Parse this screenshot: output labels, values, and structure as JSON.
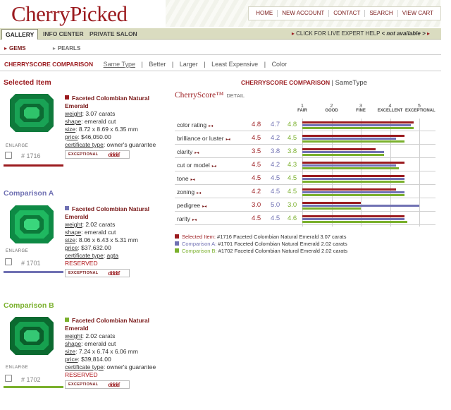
{
  "header": {
    "logo": "CherryPicked",
    "nav": [
      "HOME",
      "NEW ACCOUNT",
      "CONTACT",
      "SEARCH",
      "VIEW CART"
    ]
  },
  "tabs": [
    "GALLERY",
    "INFO CENTER",
    "PRIVATE SALON"
  ],
  "expert": {
    "text": "CLICK FOR LIVE EXPERT HELP",
    "status": "< not available >"
  },
  "subnav": {
    "gems": "GEMS",
    "pearls": "PEARLS"
  },
  "comparison_bar": {
    "label": "CHERRYSCORE COMPARISON",
    "options": [
      "Same Type",
      "Better",
      "Larger",
      "Least Expensive",
      "Color"
    ]
  },
  "colors": {
    "selected": "#9b1b1f",
    "comparison_a": "#7071b3",
    "comparison_b": "#7ab02c"
  },
  "items": [
    {
      "heading": "Selected Item",
      "name": "Faceted Colombian Natural Emerald",
      "weight_label": "weight",
      "weight": "3.07 carats",
      "shape_label": "shape",
      "shape": "emerald cut",
      "size_label": "size",
      "size": "8.72 x 8.69 x 6.35 mm",
      "price_label": "price",
      "price": "$46,050.00",
      "cert_label": "certificate type",
      "cert": "owner's guarantee",
      "status": "",
      "id": "# 1716",
      "enlarge": "ENLARGE",
      "badge": "EXCEPTIONAL"
    },
    {
      "heading": "Comparison A",
      "name": "Faceted Colombian Natural Emerald",
      "weight_label": "weight",
      "weight": "2.02 carats",
      "shape_label": "shape",
      "shape": "emerald cut",
      "size_label": "size",
      "size": "8.06 x 6.43 x 5.31 mm",
      "price_label": "price",
      "price": "$37,632.00",
      "cert_label": "certificate type",
      "cert": "agta",
      "status": "RESERVED",
      "id": "# 1701",
      "enlarge": "ENLARGE",
      "badge": "EXCEPTIONAL"
    },
    {
      "heading": "Comparison B",
      "name": "Faceted Colombian Natural Emerald",
      "weight_label": "weight",
      "weight": "2.02 carats",
      "shape_label": "shape",
      "shape": "emerald cut",
      "size_label": "size",
      "size": "7.24 x 6.74 x 6.06 mm",
      "price_label": "price",
      "price": "$39,814.00",
      "cert_label": "certificate type",
      "cert": "owner's guarantee",
      "status": "RESERVED",
      "id": "# 1702",
      "enlarge": "ENLARGE",
      "badge": "EXCEPTIONAL"
    }
  ],
  "score_panel": {
    "title_a": "CHERRYSCORE COMPARISON",
    "title_b": "SameType",
    "heading": "CherryScore™",
    "heading_sub": "DETAIL"
  },
  "chart_data": {
    "type": "bar",
    "scale": {
      "ticks": [
        1,
        2,
        3,
        4,
        5
      ],
      "tick_words": [
        "FAIR",
        "GOOD",
        "FINE",
        "EXCELLENT",
        "EXCEPTIONAL"
      ],
      "range": [
        1,
        5
      ]
    },
    "categories": [
      "color rating",
      "brilliance or luster",
      "clarity",
      "cut or model",
      "tone",
      "zoning",
      "pedigree",
      "rarity"
    ],
    "series": [
      {
        "name": "Selected Item",
        "values": [
          4.8,
          4.5,
          3.5,
          4.5,
          4.5,
          4.2,
          3.0,
          4.5
        ]
      },
      {
        "name": "Comparison A",
        "values": [
          4.7,
          4.2,
          3.8,
          4.2,
          4.5,
          4.5,
          5.0,
          4.5
        ]
      },
      {
        "name": "Comparison B",
        "values": [
          4.8,
          4.5,
          3.8,
          4.3,
          4.5,
          4.5,
          3.0,
          4.6
        ]
      }
    ],
    "legend": [
      {
        "label": "Selected Item:",
        "text": "#1716 Faceted Colombian Natural Emerald 3.07 carats"
      },
      {
        "label": "Comparison A:",
        "text": "#1701 Faceted Colombian Natural Emerald 2.02 carats"
      },
      {
        "label": "Comparison B:",
        "text": "#1702 Faceted Colombian Natural Emerald 2.02 carats"
      }
    ]
  }
}
